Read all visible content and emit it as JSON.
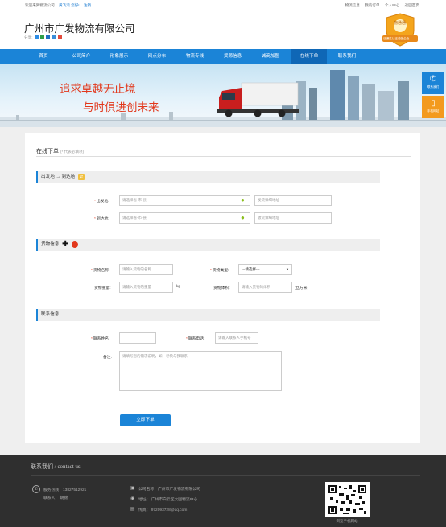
{
  "topbar": {
    "welcome": "欢迎来到物流公司",
    "login_link": "黄飞鸿 您好!",
    "register_link": "注销",
    "right_links": [
      "物流信息",
      "我的订单",
      "个人中心",
      "返回首页"
    ]
  },
  "header": {
    "company_name": "广州市广发物流有限公司",
    "share_label": "分享:",
    "badge_name": "物通通",
    "badge_caption": "已通过认证诚信企业"
  },
  "nav": {
    "items": [
      "首页",
      "公司简介",
      "形象展示",
      "网点分布",
      "物流专线",
      "货源信息",
      "诚商加盟",
      "在线下单",
      "联系我们"
    ],
    "active_index": 7,
    "active_color": "#0f67b6",
    "bar_color": "#1b84d7"
  },
  "banner": {
    "slogan_line1": "追求卓越无止境",
    "slogan_line2": "与时俱进创未来"
  },
  "side_buttons": {
    "contact": "联系我们",
    "mobile": "手机网站"
  },
  "form": {
    "page_title": "在线下单",
    "page_title_note": "(* 代表必填项)",
    "route_section": {
      "title": "出发地 → 到达地",
      "origin_label": "出发地:",
      "origin_placeholder": "请选择省-市-县",
      "origin_detail_placeholder": "发货详细地址",
      "dest_label": "到达地:",
      "dest_placeholder": "请选择省-市-县",
      "dest_detail_placeholder": "收货详细地址"
    },
    "cargo_section": {
      "title": "货物信息",
      "name_label": "货物名称:",
      "name_placeholder": "请输入货物的名称",
      "type_label": "货物类型:",
      "type_selected": "---请选择---",
      "weight_label": "货物重量:",
      "weight_placeholder": "请输入货物的重量",
      "weight_unit": "kg",
      "volume_label": "货物体积:",
      "volume_placeholder": "请输入货物的体积",
      "volume_unit": "立方米"
    },
    "contact_section": {
      "title": "联系信息",
      "name_label": "联系姓名:",
      "phone_label": "联系电话:",
      "phone_placeholder": "请输入联系人手机号",
      "remark_label": "备注:",
      "remark_placeholder": "请填写您的需求说明，如：尽快与我联系"
    },
    "submit_label": "立即下单"
  },
  "footer": {
    "title": "联系我们 / contact us",
    "hotline": "服务热线：13827512921",
    "contact_person": "联系人：  胡锦",
    "company": "公司名称：广州市广发物流有限公司",
    "address": "地址：  广州市白云区大围物流中心",
    "fax": "传真：  972093728@qq.com",
    "qr_caption": "浏览手机网站"
  }
}
